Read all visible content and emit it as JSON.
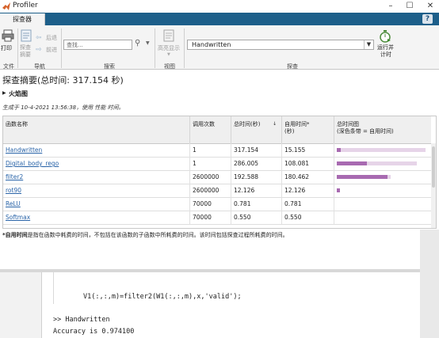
{
  "window": {
    "title": "Profiler"
  },
  "tabs": [
    {
      "label": "探查器"
    }
  ],
  "help_label": "?",
  "toolstrip": {
    "print_label": "打印",
    "summary_label_1": "探查",
    "summary_label_2": "摘要",
    "back_label": "后退",
    "forward_label": "前进",
    "search_placeholder": "查找...",
    "highlight_label": "高亮显示",
    "explore_value": "Handwritten",
    "run_label_1": "运行并",
    "run_label_2": "计时",
    "groups": {
      "file": "文件",
      "nav": "导航",
      "search": "搜索",
      "view": "视图",
      "explore": "探查"
    }
  },
  "content": {
    "summary_title": "探查摘要(总时间: 317.154 秒)",
    "flame_graph": "火焰图",
    "generated": "生成于 10-4-2021 13:56:38，使用 性能 时间。",
    "footnote_bold": "*自用时间",
    "footnote_rest": "是指在函数中耗费的时间，不包括在该函数的子函数中所耗费的时间。该时间包括探查过程所耗费的时间。"
  },
  "table": {
    "headers": {
      "name": "函数名称",
      "calls": "调用次数",
      "total": "总时间(秒)",
      "self_1": "自用时间*",
      "self_2": "(秒)",
      "plot_1": "总时间图",
      "plot_2": "(深色条带 = 自用时间)"
    },
    "rows": [
      {
        "name": "Handwritten",
        "calls": "1",
        "total": "317.154",
        "self": "15.155"
      },
      {
        "name": "Digital_body_rego",
        "calls": "1",
        "total": "286.005",
        "self": "108.081"
      },
      {
        "name": "filter2",
        "calls": "2600000",
        "total": "192.588",
        "self": "180.462"
      },
      {
        "name": "rot90",
        "calls": "2600000",
        "total": "12.126",
        "self": "12.126"
      },
      {
        "name": "ReLU",
        "calls": "70000",
        "total": "0.781",
        "self": "0.781"
      },
      {
        "name": "Softmax",
        "calls": "70000",
        "total": "0.550",
        "self": "0.550"
      }
    ]
  },
  "command_window": {
    "line1": "V1(:,:,m)=filter2(W1(:,:,m),x,'valid');",
    "line2": ">> Handwritten",
    "line3": "Accuracy is 0.974100"
  },
  "colors": {
    "tab_strip": "#1d5f8a",
    "self_bar": "#a86ab1",
    "total_bar": "#e6d4e8",
    "link": "#2a64a8"
  }
}
